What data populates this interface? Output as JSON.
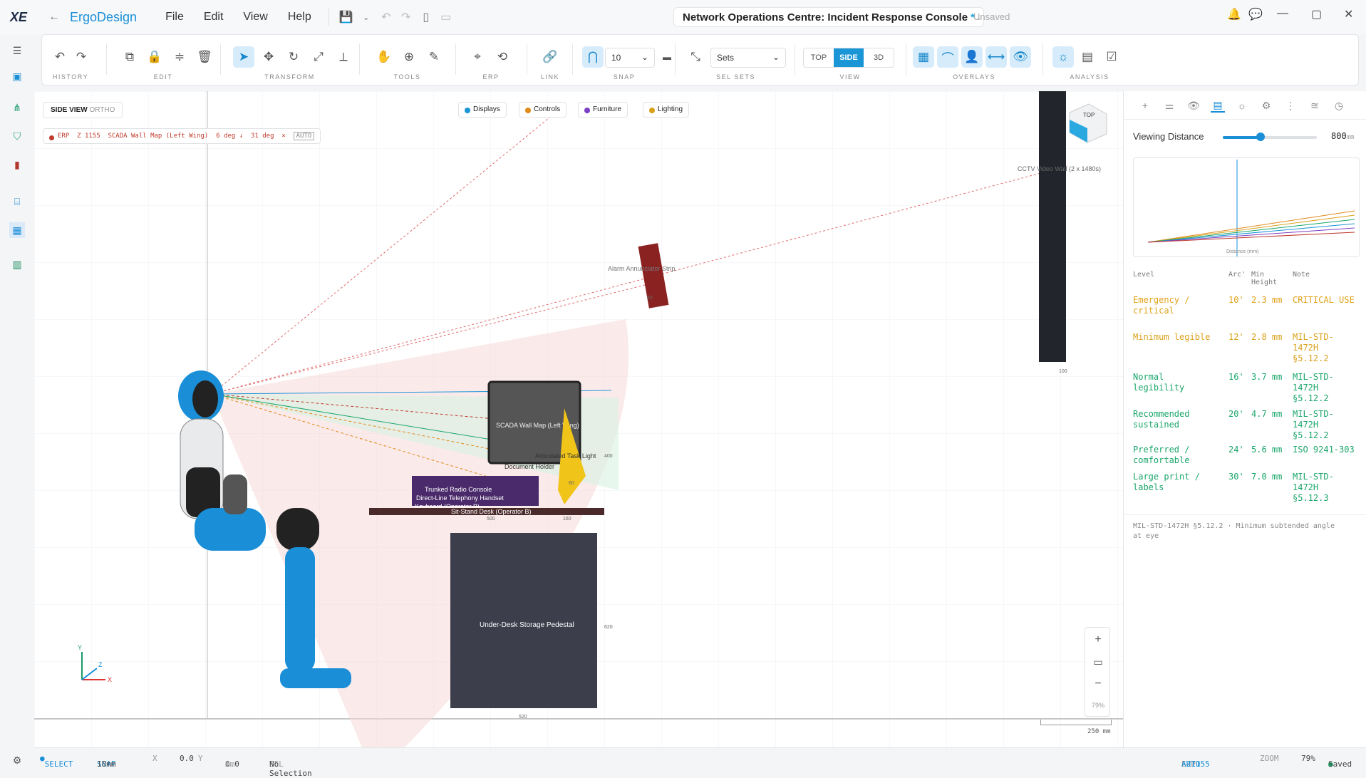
{
  "app": {
    "name_prefix": "Ergo",
    "name_suffix": "Design",
    "logo": "XE"
  },
  "menu": [
    "File",
    "Edit",
    "View",
    "Help"
  ],
  "document": {
    "title": "Network Operations Centre: Incident Response Console",
    "modified_marker": "*",
    "save_state": "Unsaved"
  },
  "toolbar": {
    "groups": [
      "HISTORY",
      "EDIT",
      "TRANSFORM",
      "TOOLS",
      "ERP",
      "LINK",
      "SNAP",
      "SEL SETS",
      "VIEW",
      "OVERLAYS",
      "ANALYSIS"
    ],
    "snap_value": "10",
    "sets_placeholder": "Sets",
    "views": [
      "TOP",
      "SIDE",
      "3D"
    ],
    "active_view": "SIDE"
  },
  "canvas": {
    "view_label": "SIDE VIEW",
    "view_mode": "ORTHO",
    "erp_chip": {
      "tag": "ERP",
      "z": "Z 1155",
      "target": "SCADA Wall Map (Left Wing)",
      "down": "6 deg ↓",
      "angle": "31 deg",
      "close": "×",
      "auto": "AUTO"
    },
    "legend": [
      {
        "label": "Displays",
        "color": "#1a95d6"
      },
      {
        "label": "Controls",
        "color": "#e08a1a"
      },
      {
        "label": "Furniture",
        "color": "#7b3fc4"
      },
      {
        "label": "Lighting",
        "color": "#d9a11a"
      }
    ],
    "labels": {
      "cctv": "CCTV Video Wall (2 x 1480s)",
      "alarm": "Alarm Annunciator Strip",
      "scada": "SCADA Wall Map (Left Wing)",
      "task_light": "Articulated Task Light",
      "doc_holder": "Document Holder",
      "radio": "Trunked Radio Console",
      "handset": "Direct-Line Telephony Handset",
      "keyboard": "Keyboard (Operator B)",
      "desk": "Sit-Stand Desk (Operator B)",
      "pedestal": "Under-Desk Storage Pedestal",
      "cube_top": "TOP"
    },
    "dims": {
      "d100": "100",
      "d400": "400",
      "d500": "500",
      "d520": "520",
      "d620": "620",
      "d80": "80",
      "d60": "60",
      "d160": "160"
    },
    "scale": {
      "value": "250 mm"
    },
    "zoom_ctl": {
      "plus": "+",
      "minus": "−",
      "pct": "79%"
    },
    "axes": {
      "x": "X",
      "y": "Y",
      "z": "Z"
    }
  },
  "right_panel": {
    "viewing_distance_label": "Viewing Distance",
    "viewing_distance": "800",
    "viewing_distance_unit": "mm",
    "slider_fraction": 0.4,
    "mini_chart_xlabel": "Distance (mm)",
    "table_headers": [
      "Level",
      "Arc'",
      "Min Height",
      "Note"
    ],
    "rows": [
      {
        "level": "Emergency / critical",
        "arc": "10'",
        "min": "2.3 mm",
        "note": "CRITICAL USE",
        "color": "#e0a21a"
      },
      {
        "level": "Minimum legible",
        "arc": "12'",
        "min": "2.8 mm",
        "note": "MIL-STD-1472H §5.12.2",
        "color": "#d9a11a"
      },
      {
        "level": "Normal legibility",
        "arc": "16'",
        "min": "3.7 mm",
        "note": "MIL-STD-1472H §5.12.2",
        "color": "#1aa66a"
      },
      {
        "level": "Recommended sustained",
        "arc": "20'",
        "min": "4.7 mm",
        "note": "MIL-STD-1472H §5.12.2",
        "color": "#1aa66a"
      },
      {
        "level": "Preferred / comfortable",
        "arc": "24'",
        "min": "5.6 mm",
        "note": "ISO 9241-303",
        "color": "#1aa66a"
      },
      {
        "level": "Large print / labels",
        "arc": "30'",
        "min": "7.0 mm",
        "note": "MIL-STD-1472H §5.12.3",
        "color": "#1aa66a"
      }
    ],
    "footnote": "MIL-STD-1472H §5.12.2 · Minimum subtended angle at eye"
  },
  "status": {
    "mode": "SELECT",
    "snap_label": "SNAP",
    "snap": "10mm",
    "x_label": "X",
    "x": "0.0",
    "y_label": "Y",
    "y": "0.0",
    "unit": "mm",
    "sel_label": "SEL",
    "sel": "No Selection",
    "erp_label": "ERP",
    "erp": "AUTO",
    "z": "Z1155",
    "zoom_label": "ZOOM",
    "zoom": "79%",
    "saved": "Saved"
  }
}
